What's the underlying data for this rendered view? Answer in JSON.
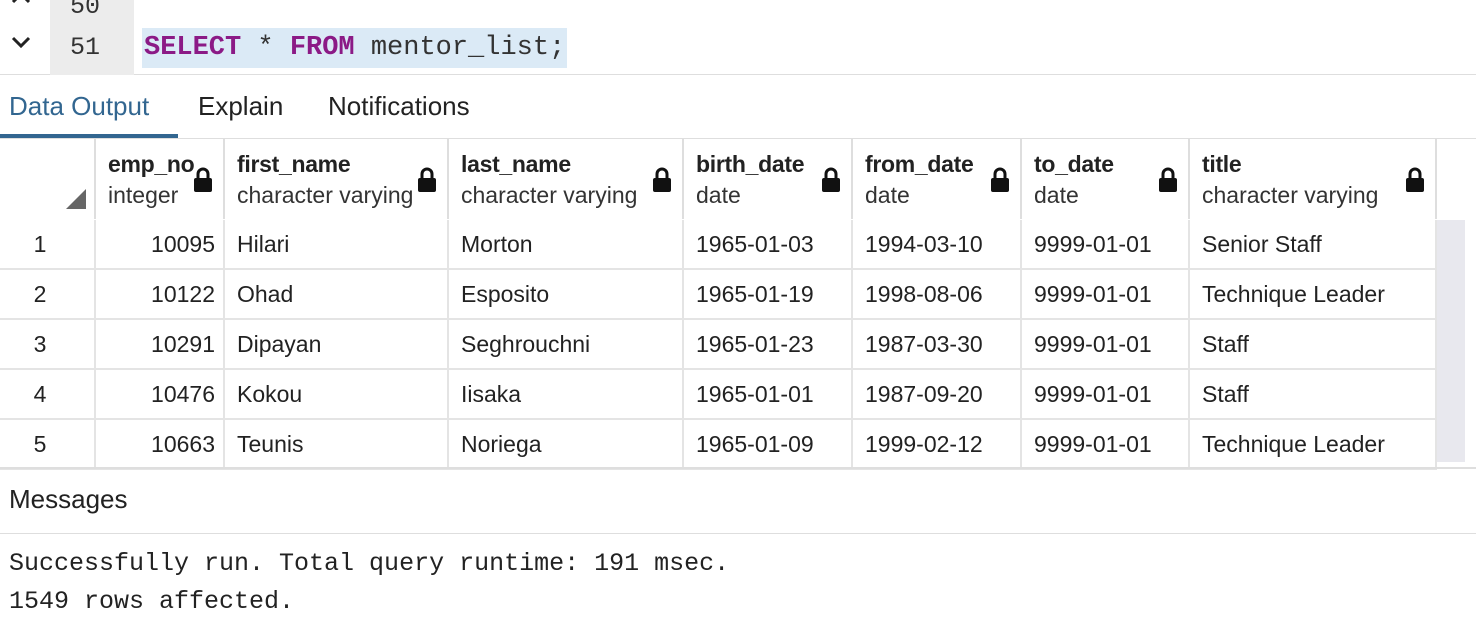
{
  "editor": {
    "lines": [
      {
        "number": "50"
      },
      {
        "number": "51",
        "keyword1": "SELECT",
        "middle": " * ",
        "keyword2": "FROM",
        "rest": " mentor_list;"
      }
    ]
  },
  "tabs": [
    {
      "label": "Data Output",
      "active": true
    },
    {
      "label": "Explain",
      "active": false
    },
    {
      "label": "Notifications",
      "active": false
    }
  ],
  "grid": {
    "columns": [
      {
        "name": "emp_no",
        "type": "integer"
      },
      {
        "name": "first_name",
        "type": "character varying"
      },
      {
        "name": "last_name",
        "type": "character varying"
      },
      {
        "name": "birth_date",
        "type": "date"
      },
      {
        "name": "from_date",
        "type": "date"
      },
      {
        "name": "to_date",
        "type": "date"
      },
      {
        "name": "title",
        "type": "character varying"
      }
    ],
    "rows": [
      {
        "n": "1",
        "cells": [
          "10095",
          "Hilari",
          "Morton",
          "1965-01-03",
          "1994-03-10",
          "9999-01-01",
          "Senior Staff"
        ]
      },
      {
        "n": "2",
        "cells": [
          "10122",
          "Ohad",
          "Esposito",
          "1965-01-19",
          "1998-08-06",
          "9999-01-01",
          "Technique Leader"
        ]
      },
      {
        "n": "3",
        "cells": [
          "10291",
          "Dipayan",
          "Seghrouchni",
          "1965-01-23",
          "1987-03-30",
          "9999-01-01",
          "Staff"
        ]
      },
      {
        "n": "4",
        "cells": [
          "10476",
          "Kokou",
          "Iisaka",
          "1965-01-01",
          "1987-09-20",
          "9999-01-01",
          "Staff"
        ]
      },
      {
        "n": "5",
        "cells": [
          "10663",
          "Teunis",
          "Noriega",
          "1965-01-09",
          "1999-02-12",
          "9999-01-01",
          "Technique Leader"
        ]
      }
    ]
  },
  "messages": {
    "title": "Messages",
    "lines": [
      "Successfully run. Total query runtime: 191 msec.",
      "1549 rows affected."
    ]
  },
  "colors": {
    "accent": "#326690",
    "sql_keyword": "#8b1a86",
    "line_highlight": "#dbeaf6"
  },
  "icons": [
    "chevron-down-icon",
    "lock-icon",
    "sort-corner-icon"
  ]
}
